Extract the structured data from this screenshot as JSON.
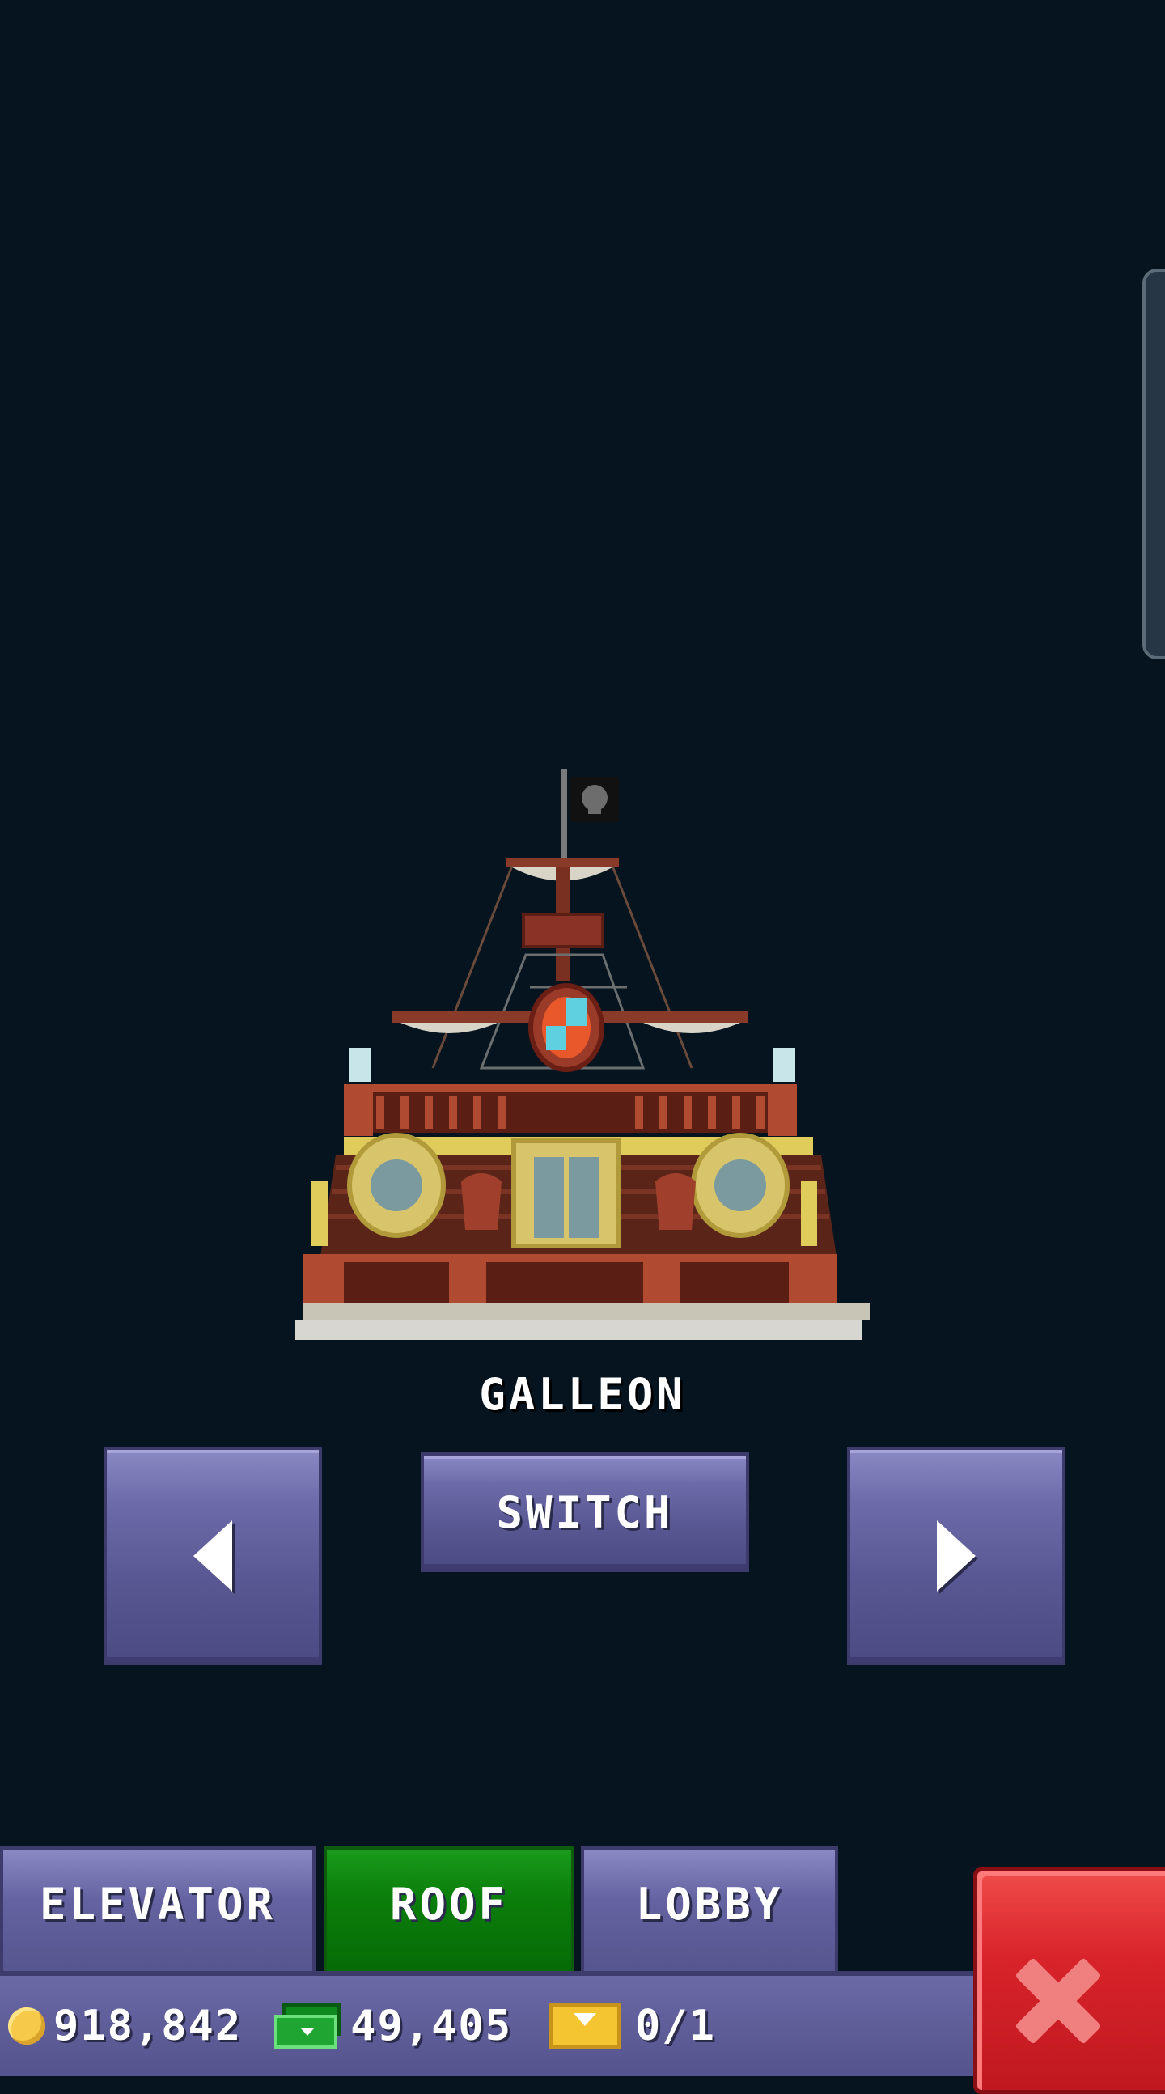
{
  "item": {
    "name": "GALLEON"
  },
  "controls": {
    "prev_icon": "arrow-left-icon",
    "next_icon": "arrow-right-icon",
    "switch_label": "SWITCH"
  },
  "tabs": [
    {
      "label": "ELEVATOR",
      "active": false
    },
    {
      "label": "ROOF",
      "active": true
    },
    {
      "label": "LOBBY",
      "active": false
    }
  ],
  "status": {
    "coins": "918,842",
    "bux": "49,405",
    "tickets": "0/1"
  },
  "close_icon": "close-x-icon",
  "colors": {
    "background": "#06141f",
    "button_purple": "#6c6aa8",
    "active_tab_green": "#0a7d0a",
    "close_red": "#d8232a"
  }
}
